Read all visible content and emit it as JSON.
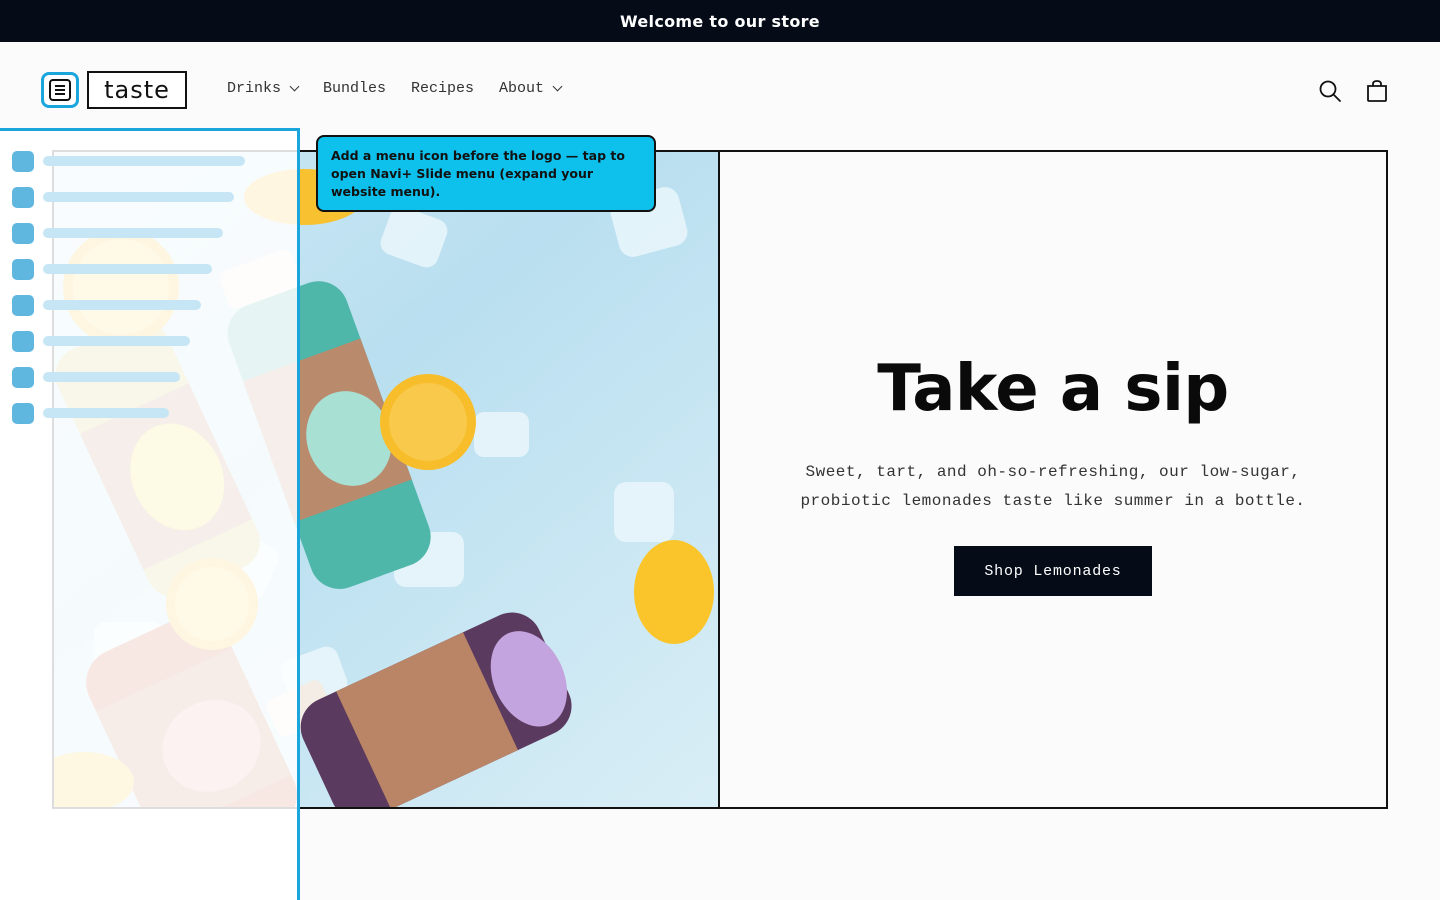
{
  "announcement": "Welcome to our store",
  "header": {
    "logo_text": "taste",
    "nav": [
      {
        "label": "Drinks",
        "has_dropdown": true
      },
      {
        "label": "Bundles",
        "has_dropdown": false
      },
      {
        "label": "Recipes",
        "has_dropdown": false
      },
      {
        "label": "About",
        "has_dropdown": true
      }
    ],
    "icons": [
      "search-icon",
      "cart-icon"
    ]
  },
  "hero": {
    "title": "Take a sip",
    "text": "Sweet, tart, and oh-so-refreshing, our low-sugar, probiotic lemonades taste like summer in a bottle.",
    "button_label": "Shop Lemonades"
  },
  "tooltip": "Add a menu icon before the logo — tap to open Navi+ Slide menu (expand your website menu).",
  "slide_menu": {
    "item_count": 8
  },
  "colors": {
    "accent": "#1aa6dd",
    "tooltip_bg": "#0ec0ec",
    "dark": "#050b17"
  }
}
